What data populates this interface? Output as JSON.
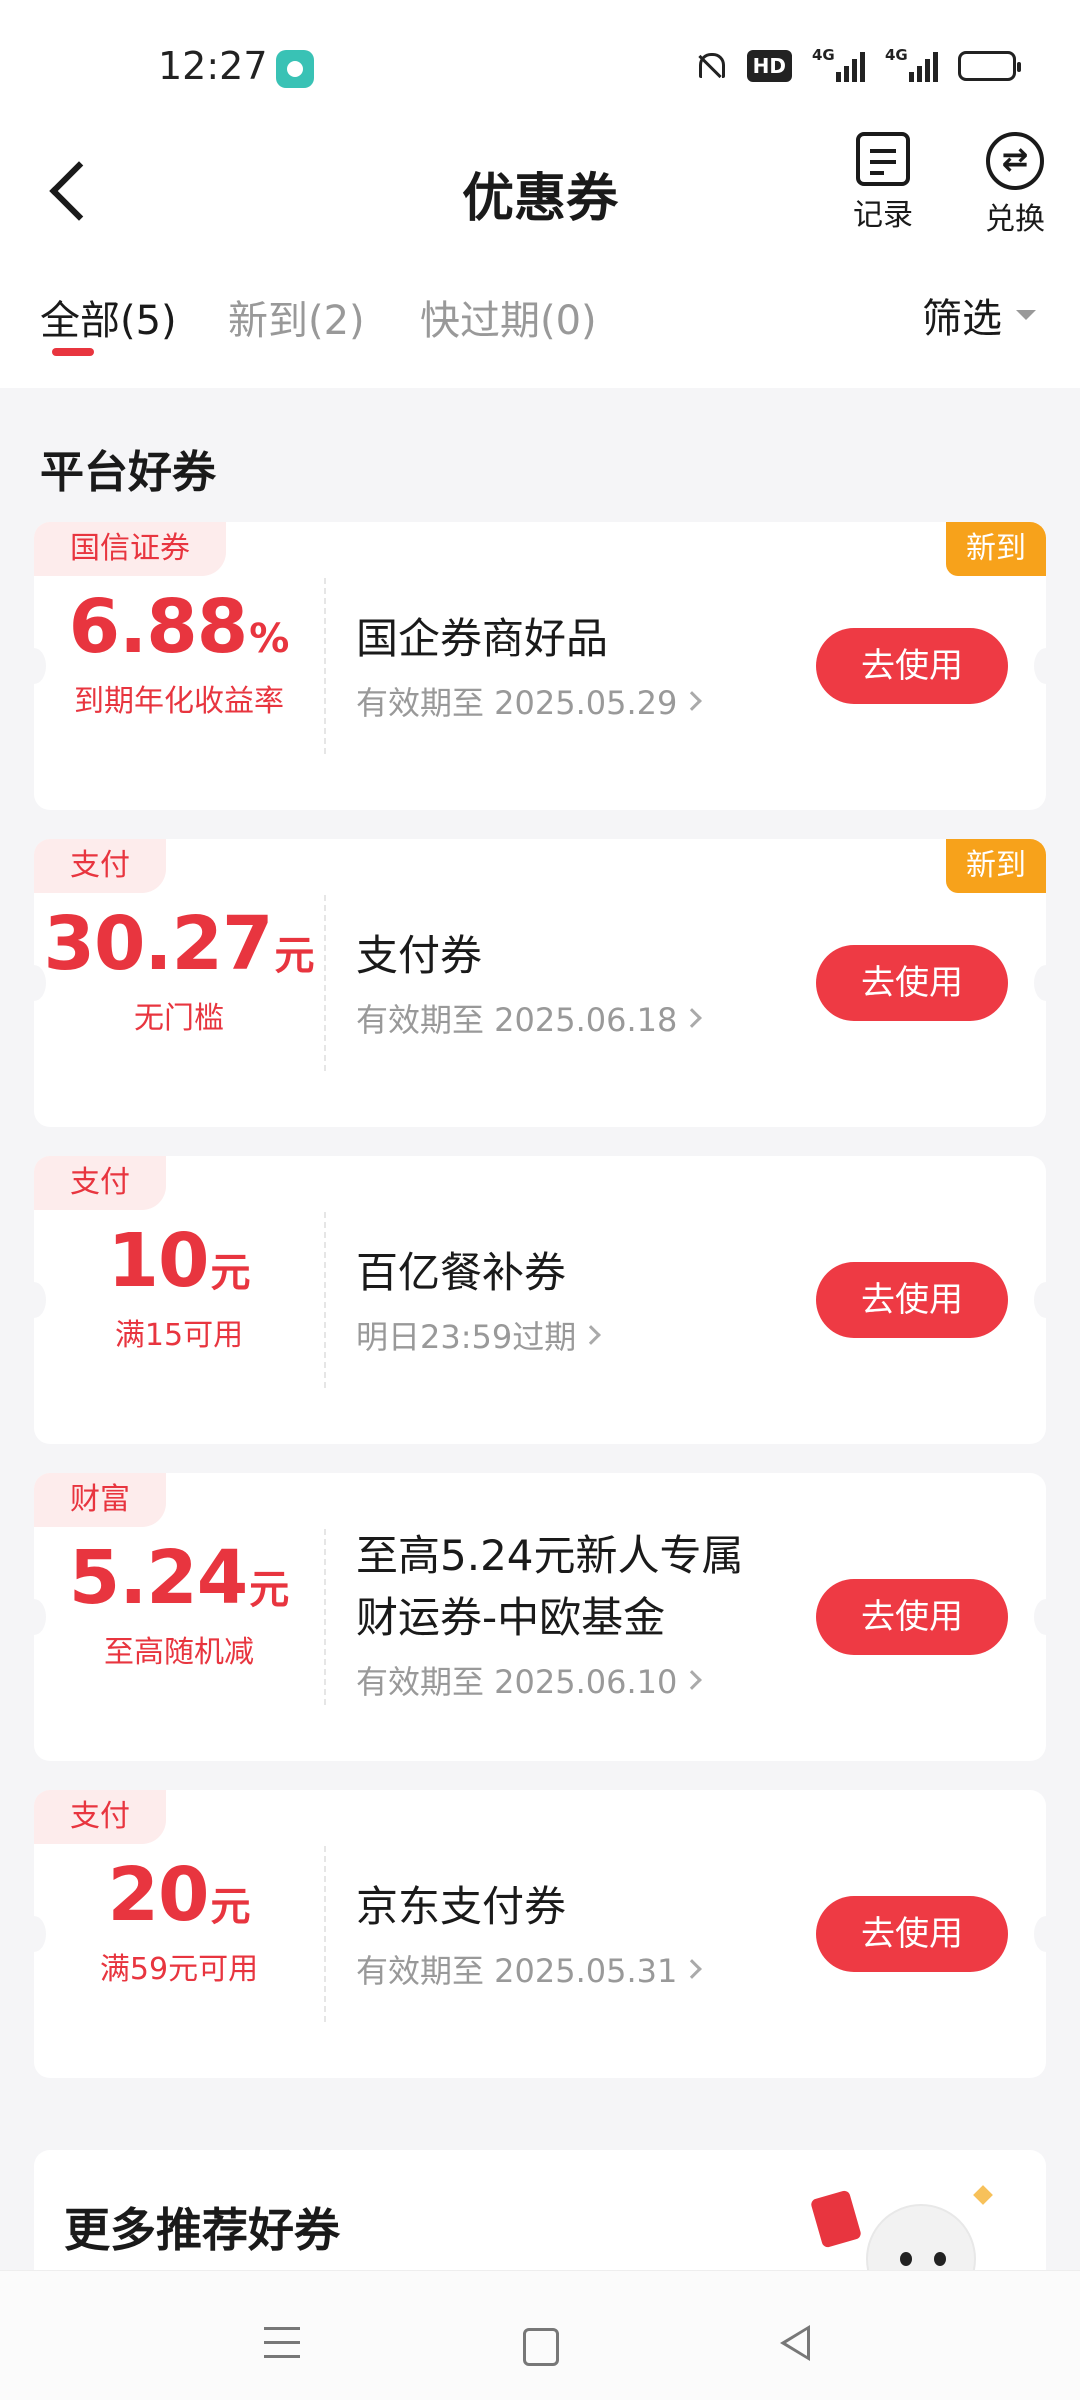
{
  "status_bar": {
    "time": "12:27",
    "hd_label": "HD",
    "signal1_label": "4G",
    "signal2_label": "4G",
    "battery_level": 0.55,
    "icons": [
      "app-notification-icon",
      "mute-bell-icon",
      "hd-icon",
      "signal-icon",
      "signal-icon",
      "battery-icon"
    ]
  },
  "header": {
    "title": "优惠券",
    "record_label": "记录",
    "exchange_label": "兑换"
  },
  "tabs": [
    {
      "label": "全部(5)",
      "active": true
    },
    {
      "label": "新到(2)",
      "active": false
    },
    {
      "label": "快过期(0)",
      "active": false
    }
  ],
  "filter_label": "筛选",
  "section_title": "平台好券",
  "coupons": [
    {
      "category": "国信证券",
      "new_tag": "新到",
      "value": "6.88",
      "unit": "%",
      "condition": "到期年化收益率",
      "name": "国企券商好品",
      "name_line2": "",
      "validity": "有效期至 2025.05.29",
      "button": "去使用"
    },
    {
      "category": "支付",
      "new_tag": "新到",
      "value": "30.27",
      "unit": "元",
      "condition": "无门槛",
      "name": "支付券",
      "name_line2": "",
      "validity": "有效期至 2025.06.18",
      "button": "去使用"
    },
    {
      "category": "支付",
      "new_tag": "",
      "value": "10",
      "unit": "元",
      "condition": "满15可用",
      "name": "百亿餐补券",
      "name_line2": "",
      "validity": "明日23:59过期",
      "button": "去使用"
    },
    {
      "category": "财富",
      "new_tag": "",
      "value": "5.24",
      "unit": "元",
      "condition": "至高随机减",
      "name": "至高5.24元新人专属",
      "name_line2": "财运券-中欧基金",
      "validity": "有效期至 2025.06.10",
      "button": "去使用"
    },
    {
      "category": "支付",
      "new_tag": "",
      "value": "20",
      "unit": "元",
      "condition": "满59元可用",
      "name": "京东支付券",
      "name_line2": "",
      "validity": "有效期至 2025.05.31",
      "button": "去使用"
    }
  ],
  "more_section": {
    "title": "更多推荐好券"
  },
  "colors": {
    "accent": "#e8353f",
    "new_tag": "#f7a21b",
    "background": "#f5f5f7"
  },
  "nav_bar": {
    "icons": [
      "menu-icon",
      "home-icon",
      "back-triangle-icon"
    ]
  }
}
